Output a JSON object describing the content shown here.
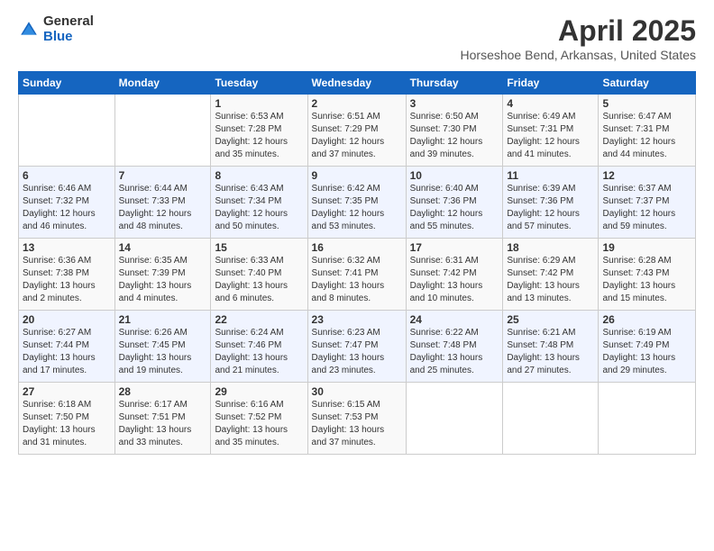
{
  "logo": {
    "general": "General",
    "blue": "Blue"
  },
  "title": "April 2025",
  "subtitle": "Horseshoe Bend, Arkansas, United States",
  "calendar": {
    "headers": [
      "Sunday",
      "Monday",
      "Tuesday",
      "Wednesday",
      "Thursday",
      "Friday",
      "Saturday"
    ],
    "weeks": [
      [
        {
          "day": "",
          "sunrise": "",
          "sunset": "",
          "daylight": ""
        },
        {
          "day": "",
          "sunrise": "",
          "sunset": "",
          "daylight": ""
        },
        {
          "day": "1",
          "sunrise": "Sunrise: 6:53 AM",
          "sunset": "Sunset: 7:28 PM",
          "daylight": "Daylight: 12 hours and 35 minutes."
        },
        {
          "day": "2",
          "sunrise": "Sunrise: 6:51 AM",
          "sunset": "Sunset: 7:29 PM",
          "daylight": "Daylight: 12 hours and 37 minutes."
        },
        {
          "day": "3",
          "sunrise": "Sunrise: 6:50 AM",
          "sunset": "Sunset: 7:30 PM",
          "daylight": "Daylight: 12 hours and 39 minutes."
        },
        {
          "day": "4",
          "sunrise": "Sunrise: 6:49 AM",
          "sunset": "Sunset: 7:31 PM",
          "daylight": "Daylight: 12 hours and 41 minutes."
        },
        {
          "day": "5",
          "sunrise": "Sunrise: 6:47 AM",
          "sunset": "Sunset: 7:31 PM",
          "daylight": "Daylight: 12 hours and 44 minutes."
        }
      ],
      [
        {
          "day": "6",
          "sunrise": "Sunrise: 6:46 AM",
          "sunset": "Sunset: 7:32 PM",
          "daylight": "Daylight: 12 hours and 46 minutes."
        },
        {
          "day": "7",
          "sunrise": "Sunrise: 6:44 AM",
          "sunset": "Sunset: 7:33 PM",
          "daylight": "Daylight: 12 hours and 48 minutes."
        },
        {
          "day": "8",
          "sunrise": "Sunrise: 6:43 AM",
          "sunset": "Sunset: 7:34 PM",
          "daylight": "Daylight: 12 hours and 50 minutes."
        },
        {
          "day": "9",
          "sunrise": "Sunrise: 6:42 AM",
          "sunset": "Sunset: 7:35 PM",
          "daylight": "Daylight: 12 hours and 53 minutes."
        },
        {
          "day": "10",
          "sunrise": "Sunrise: 6:40 AM",
          "sunset": "Sunset: 7:36 PM",
          "daylight": "Daylight: 12 hours and 55 minutes."
        },
        {
          "day": "11",
          "sunrise": "Sunrise: 6:39 AM",
          "sunset": "Sunset: 7:36 PM",
          "daylight": "Daylight: 12 hours and 57 minutes."
        },
        {
          "day": "12",
          "sunrise": "Sunrise: 6:37 AM",
          "sunset": "Sunset: 7:37 PM",
          "daylight": "Daylight: 12 hours and 59 minutes."
        }
      ],
      [
        {
          "day": "13",
          "sunrise": "Sunrise: 6:36 AM",
          "sunset": "Sunset: 7:38 PM",
          "daylight": "Daylight: 13 hours and 2 minutes."
        },
        {
          "day": "14",
          "sunrise": "Sunrise: 6:35 AM",
          "sunset": "Sunset: 7:39 PM",
          "daylight": "Daylight: 13 hours and 4 minutes."
        },
        {
          "day": "15",
          "sunrise": "Sunrise: 6:33 AM",
          "sunset": "Sunset: 7:40 PM",
          "daylight": "Daylight: 13 hours and 6 minutes."
        },
        {
          "day": "16",
          "sunrise": "Sunrise: 6:32 AM",
          "sunset": "Sunset: 7:41 PM",
          "daylight": "Daylight: 13 hours and 8 minutes."
        },
        {
          "day": "17",
          "sunrise": "Sunrise: 6:31 AM",
          "sunset": "Sunset: 7:42 PM",
          "daylight": "Daylight: 13 hours and 10 minutes."
        },
        {
          "day": "18",
          "sunrise": "Sunrise: 6:29 AM",
          "sunset": "Sunset: 7:42 PM",
          "daylight": "Daylight: 13 hours and 13 minutes."
        },
        {
          "day": "19",
          "sunrise": "Sunrise: 6:28 AM",
          "sunset": "Sunset: 7:43 PM",
          "daylight": "Daylight: 13 hours and 15 minutes."
        }
      ],
      [
        {
          "day": "20",
          "sunrise": "Sunrise: 6:27 AM",
          "sunset": "Sunset: 7:44 PM",
          "daylight": "Daylight: 13 hours and 17 minutes."
        },
        {
          "day": "21",
          "sunrise": "Sunrise: 6:26 AM",
          "sunset": "Sunset: 7:45 PM",
          "daylight": "Daylight: 13 hours and 19 minutes."
        },
        {
          "day": "22",
          "sunrise": "Sunrise: 6:24 AM",
          "sunset": "Sunset: 7:46 PM",
          "daylight": "Daylight: 13 hours and 21 minutes."
        },
        {
          "day": "23",
          "sunrise": "Sunrise: 6:23 AM",
          "sunset": "Sunset: 7:47 PM",
          "daylight": "Daylight: 13 hours and 23 minutes."
        },
        {
          "day": "24",
          "sunrise": "Sunrise: 6:22 AM",
          "sunset": "Sunset: 7:48 PM",
          "daylight": "Daylight: 13 hours and 25 minutes."
        },
        {
          "day": "25",
          "sunrise": "Sunrise: 6:21 AM",
          "sunset": "Sunset: 7:48 PM",
          "daylight": "Daylight: 13 hours and 27 minutes."
        },
        {
          "day": "26",
          "sunrise": "Sunrise: 6:19 AM",
          "sunset": "Sunset: 7:49 PM",
          "daylight": "Daylight: 13 hours and 29 minutes."
        }
      ],
      [
        {
          "day": "27",
          "sunrise": "Sunrise: 6:18 AM",
          "sunset": "Sunset: 7:50 PM",
          "daylight": "Daylight: 13 hours and 31 minutes."
        },
        {
          "day": "28",
          "sunrise": "Sunrise: 6:17 AM",
          "sunset": "Sunset: 7:51 PM",
          "daylight": "Daylight: 13 hours and 33 minutes."
        },
        {
          "day": "29",
          "sunrise": "Sunrise: 6:16 AM",
          "sunset": "Sunset: 7:52 PM",
          "daylight": "Daylight: 13 hours and 35 minutes."
        },
        {
          "day": "30",
          "sunrise": "Sunrise: 6:15 AM",
          "sunset": "Sunset: 7:53 PM",
          "daylight": "Daylight: 13 hours and 37 minutes."
        },
        {
          "day": "",
          "sunrise": "",
          "sunset": "",
          "daylight": ""
        },
        {
          "day": "",
          "sunrise": "",
          "sunset": "",
          "daylight": ""
        },
        {
          "day": "",
          "sunrise": "",
          "sunset": "",
          "daylight": ""
        }
      ]
    ]
  }
}
